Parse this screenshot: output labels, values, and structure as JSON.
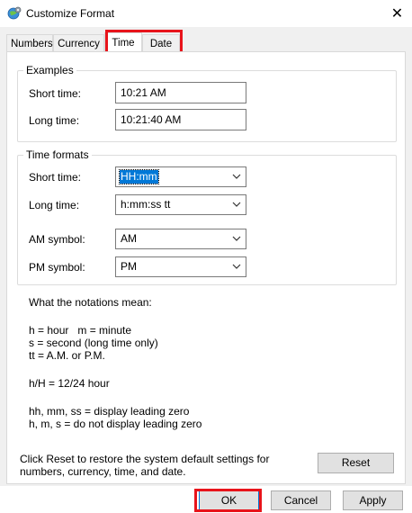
{
  "window": {
    "title": "Customize Format",
    "close_icon": "close-icon"
  },
  "tabs": [
    {
      "label": "Numbers",
      "active": false
    },
    {
      "label": "Currency",
      "active": false
    },
    {
      "label": "Time",
      "active": true
    },
    {
      "label": "Date",
      "active": false
    }
  ],
  "examples": {
    "group_label": "Examples",
    "short_time_label": "Short time:",
    "short_time_value": "10:21 AM",
    "long_time_label": "Long time:",
    "long_time_value": "10:21:40 AM"
  },
  "time_formats": {
    "group_label": "Time formats",
    "short_time_label": "Short time:",
    "short_time_value": "HH:mm",
    "long_time_label": "Long time:",
    "long_time_value": "h:mm:ss tt",
    "am_label": "AM symbol:",
    "am_value": "AM",
    "pm_label": "PM symbol:",
    "pm_value": "PM"
  },
  "notations": {
    "heading": "What the notations mean:",
    "line1": "h = hour   m = minute",
    "line2": "s = second (long time only)",
    "line3": "tt = A.M. or P.M.",
    "line4": "h/H = 12/24 hour",
    "line5": "hh, mm, ss = display leading zero",
    "line6": "h, m, s = do not display leading zero"
  },
  "reset": {
    "text_line1": "Click Reset to restore the system default settings for",
    "text_line2": "numbers, currency, time, and date.",
    "button_label": "Reset"
  },
  "footer": {
    "ok_label": "OK",
    "cancel_label": "Cancel",
    "apply_label": "Apply"
  },
  "colors": {
    "highlight": "#e8141b",
    "selection": "#0078d7",
    "dialog_bg": "#f0f0f0"
  }
}
